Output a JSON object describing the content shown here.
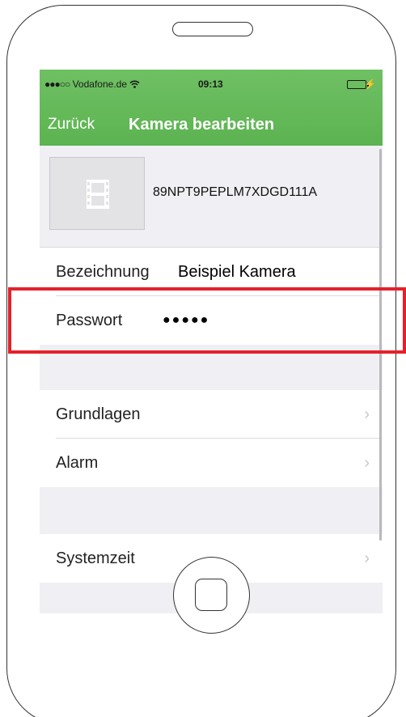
{
  "status_bar": {
    "signal": "●●●○○",
    "carrier": "Vodafone.de",
    "wifi": "wifi-icon",
    "time": "09:13",
    "battery": "battery-icon",
    "charging": "⚡"
  },
  "nav": {
    "back_label": "Zurück",
    "title": "Kamera bearbeiten",
    "accent": "#5cb351"
  },
  "camera": {
    "id": "89NPT9PEPLM7XDGD111A",
    "thumbnail_icon": "film-icon"
  },
  "fields": {
    "name_label": "Bezeichnung",
    "name_value": "Beispiel Kamera",
    "password_label": "Passwort",
    "password_value": "●●●●●"
  },
  "menu": {
    "basics": "Grundlagen",
    "alarm": "Alarm",
    "systemtime": "Systemzeit",
    "chevron": "›"
  },
  "highlight_color": "#e4212b"
}
